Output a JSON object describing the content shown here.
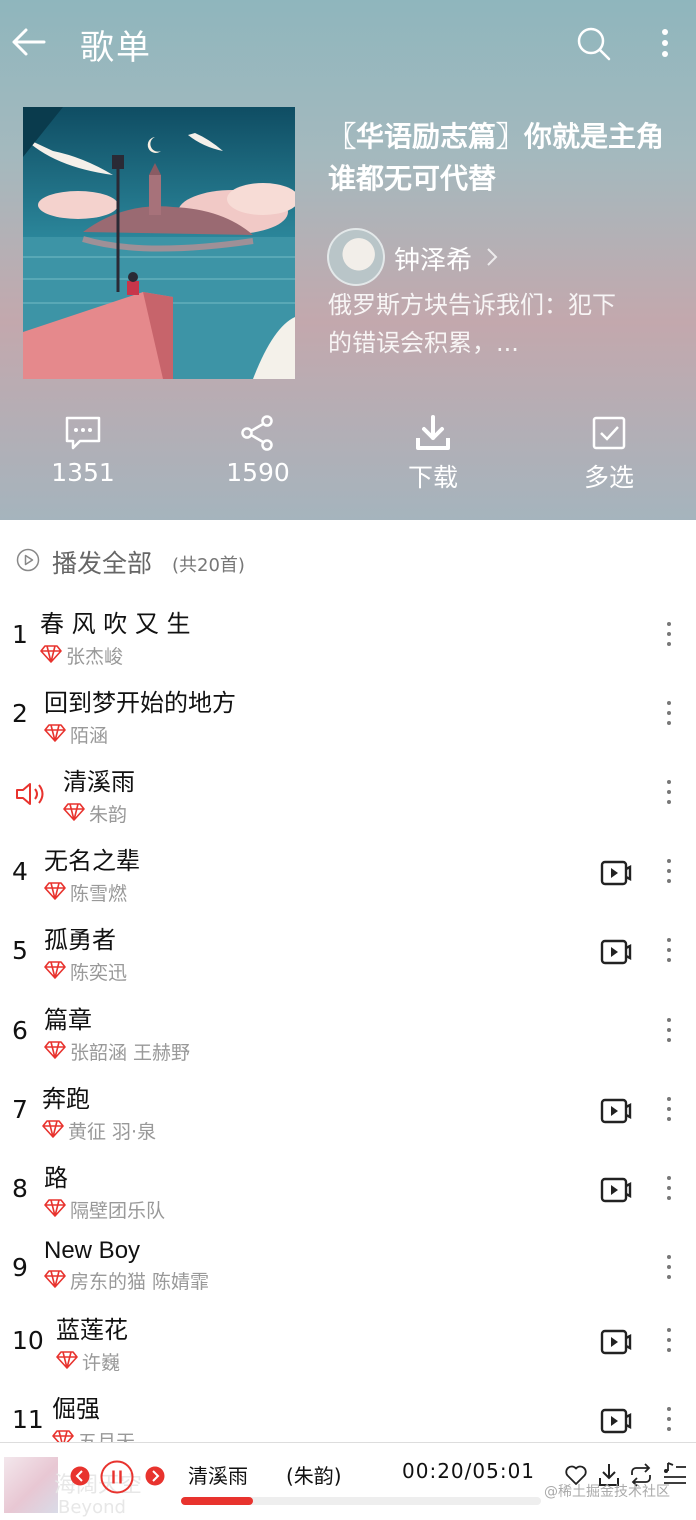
{
  "header": {
    "title": "歌单",
    "playlist_title": "〖华语励志篇〗你就是主角 谁都无可代替",
    "creator": "钟泽希",
    "description": "俄罗斯方块告诉我们：犯下的错误会积累，..."
  },
  "actions": {
    "comments": "1351",
    "shares": "1590",
    "download": "下载",
    "multi_select": "多选"
  },
  "play_all": {
    "label": "播发全部",
    "count": "(共20首)"
  },
  "songs": [
    {
      "index": "1",
      "title": "春 风 吹 又 生",
      "artist": "张杰峻",
      "mv": false,
      "playing": false
    },
    {
      "index": "2",
      "title": "回到梦开始的地方",
      "artist": "陌涵",
      "mv": false,
      "playing": false
    },
    {
      "index": "3",
      "title": "清溪雨",
      "artist": "朱韵",
      "mv": false,
      "playing": true
    },
    {
      "index": "4",
      "title": "无名之辈",
      "artist": "陈雪燃",
      "mv": true,
      "playing": false
    },
    {
      "index": "5",
      "title": "孤勇者",
      "artist": "陈奕迅",
      "mv": true,
      "playing": false
    },
    {
      "index": "6",
      "title": "篇章",
      "artist": "张韶涵 王赫野",
      "mv": false,
      "playing": false
    },
    {
      "index": "7",
      "title": "奔跑",
      "artist": "黄征 羽·泉",
      "mv": true,
      "playing": false
    },
    {
      "index": "8",
      "title": "路",
      "artist": "隔壁团乐队",
      "mv": true,
      "playing": false
    },
    {
      "index": "9",
      "title": "New Boy",
      "artist": "房东的猫 陈婧霏",
      "mv": false,
      "playing": false
    },
    {
      "index": "10",
      "title": "蓝莲花",
      "artist": "许巍",
      "mv": true,
      "playing": false
    },
    {
      "index": "11",
      "title": "倔强",
      "artist": "五月天",
      "mv": true,
      "playing": false
    }
  ],
  "player": {
    "song": "清溪雨",
    "artist": "(朱韵)",
    "time": "00:20/05:01",
    "progress": 0.2,
    "ghost_title": "海阔天空",
    "ghost_artist": "Beyond"
  },
  "watermark": "@稀土掘金技术社区",
  "colors": {
    "accent": "#e8332e",
    "vip": "#e8332e",
    "artist_text": "#999999"
  },
  "icons": {
    "back": "arrow-left-icon",
    "search": "search-icon",
    "more": "more-vertical-icon",
    "comment": "comment-icon",
    "share": "share-icon",
    "download": "download-icon",
    "select": "checkbox-icon",
    "play_all": "play-circle-icon",
    "playing": "speaker-icon",
    "vip": "diamond-icon",
    "mv": "video-icon",
    "song_menu": "more-vertical-icon"
  }
}
